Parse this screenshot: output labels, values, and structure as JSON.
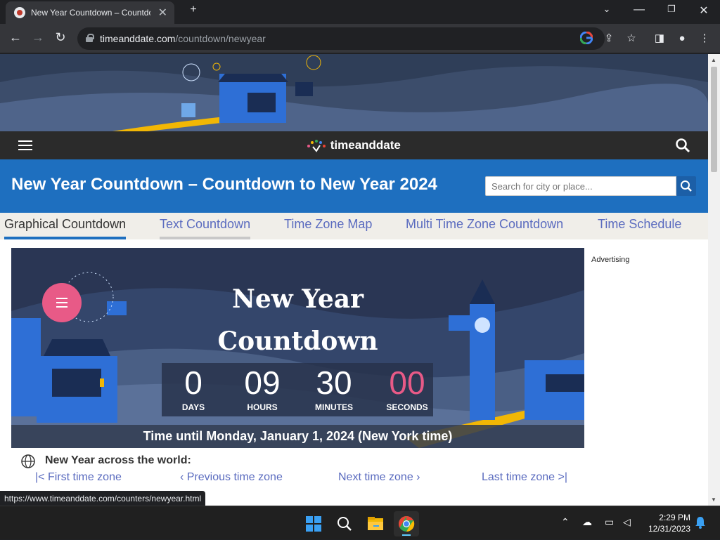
{
  "browser": {
    "tab_title": "New Year Countdown – Countdown",
    "new_tab": "+",
    "url_domain": "timeanddate.com",
    "url_path": "/countdown/newyear"
  },
  "site": {
    "logo_text": "timeanddate",
    "page_title": "New Year Countdown – Countdown to New Year 2024",
    "search_placeholder": "Search for city or place..."
  },
  "tabs": [
    {
      "label": "Graphical Countdown",
      "active": true
    },
    {
      "label": "Text Countdown",
      "active": false
    },
    {
      "label": "Time Zone Map",
      "active": false
    },
    {
      "label": "Multi Time Zone Countdown",
      "active": false
    },
    {
      "label": "Time Schedule",
      "active": false
    }
  ],
  "countdown": {
    "title_line1": "New Year",
    "title_line2": "Countdown",
    "days": "0",
    "days_label": "DAYS",
    "hours": "09",
    "hours_label": "HOURS",
    "minutes": "30",
    "minutes_label": "MINUTES",
    "seconds": "00",
    "seconds_label": "SECONDS",
    "time_until": "Time until Monday, January 1, 2024 (New York time)"
  },
  "advertising": "Advertising",
  "world": {
    "heading": "New Year across the world:",
    "first": "First time zone",
    "previous": "Previous time zone",
    "next": "Next time zone",
    "last": "Last time zone"
  },
  "status_url": "https://www.timeanddate.com/counters/newyear.html",
  "taskbar": {
    "time": "2:29 PM",
    "date": "12/31/2023"
  },
  "colors": {
    "site_blue": "#1e6fbf",
    "seconds_pink": "#e85a87",
    "link": "#5a6bbf"
  }
}
